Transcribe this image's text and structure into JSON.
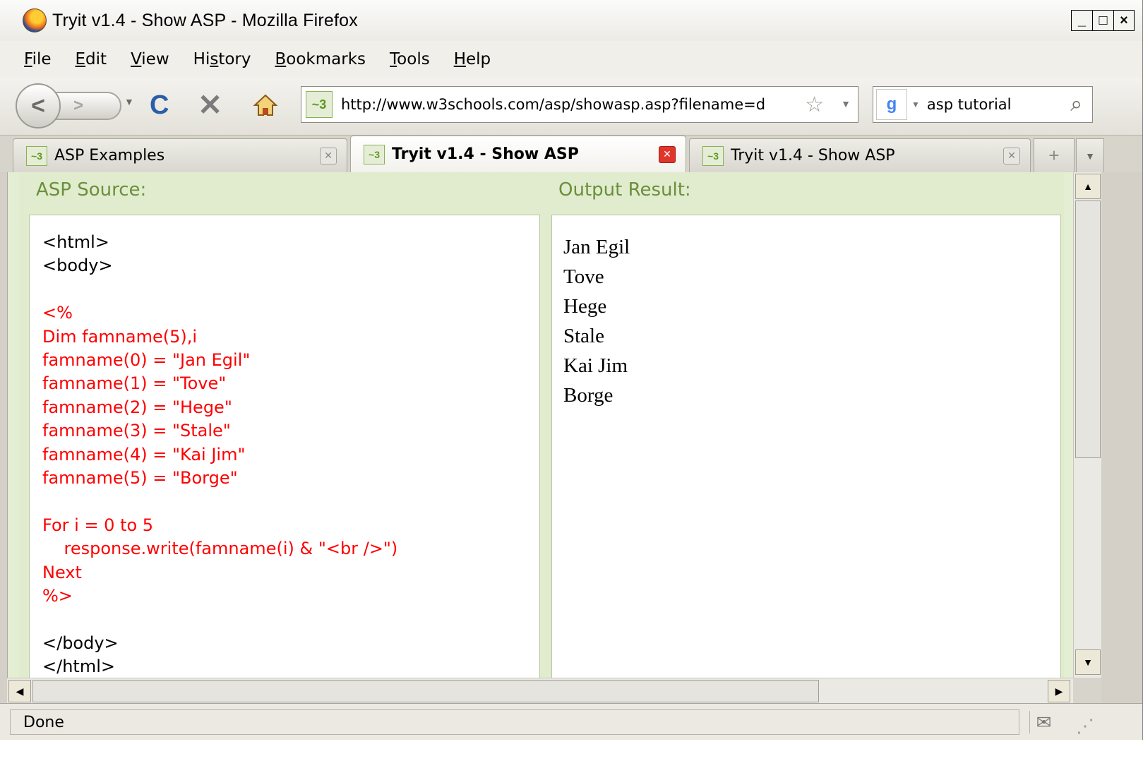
{
  "window": {
    "title": "Tryit v1.4 - Show ASP - Mozilla Firefox",
    "controls": {
      "minimize": "_",
      "maximize": "□",
      "close": "×"
    }
  },
  "menubar": {
    "items": [
      {
        "prefix": "",
        "accel": "F",
        "rest": "ile"
      },
      {
        "prefix": "",
        "accel": "E",
        "rest": "dit"
      },
      {
        "prefix": "",
        "accel": "V",
        "rest": "iew"
      },
      {
        "prefix": "Hi",
        "accel": "s",
        "rest": "tory"
      },
      {
        "prefix": "",
        "accel": "B",
        "rest": "ookmarks"
      },
      {
        "prefix": "",
        "accel": "T",
        "rest": "ools"
      },
      {
        "prefix": "",
        "accel": "H",
        "rest": "elp"
      }
    ]
  },
  "toolbar": {
    "url": "http://www.w3schools.com/asp/showasp.asp?filename=d",
    "search_engine_icon": "google-icon",
    "search_value": "asp tutorial"
  },
  "tabs": [
    {
      "label": "ASP Examples",
      "active": false
    },
    {
      "label": "Tryit v1.4 - Show ASP",
      "active": true
    },
    {
      "label": "Tryit v1.4 - Show ASP",
      "active": false
    }
  ],
  "page": {
    "source_heading": "ASP Source:",
    "output_heading": "Output Result:",
    "source_lines": [
      {
        "text": "<html>",
        "asp": false
      },
      {
        "text": "<body>",
        "asp": false
      },
      {
        "text": "",
        "asp": false
      },
      {
        "text": "<%",
        "asp": true
      },
      {
        "text": "Dim famname(5),i",
        "asp": true
      },
      {
        "text": "famname(0) = \"Jan Egil\"",
        "asp": true
      },
      {
        "text": "famname(1) = \"Tove\"",
        "asp": true
      },
      {
        "text": "famname(2) = \"Hege\"",
        "asp": true
      },
      {
        "text": "famname(3) = \"Stale\"",
        "asp": true
      },
      {
        "text": "famname(4) = \"Kai Jim\"",
        "asp": true
      },
      {
        "text": "famname(5) = \"Borge\"",
        "asp": true
      },
      {
        "text": "",
        "asp": false
      },
      {
        "text": "For i = 0 to 5",
        "asp": true
      },
      {
        "text": "    response.write(famname(i) & \"<br />\")",
        "asp": true
      },
      {
        "text": "Next",
        "asp": true
      },
      {
        "text": "%>",
        "asp": true
      },
      {
        "text": "",
        "asp": false
      },
      {
        "text": "</body>",
        "asp": false
      },
      {
        "text": "</html>",
        "asp": false
      }
    ],
    "output_lines": [
      "Jan Egil",
      "Tove",
      "Hege",
      "Stale",
      "Kai Jim",
      "Borge"
    ]
  },
  "statusbar": {
    "text": "Done"
  }
}
